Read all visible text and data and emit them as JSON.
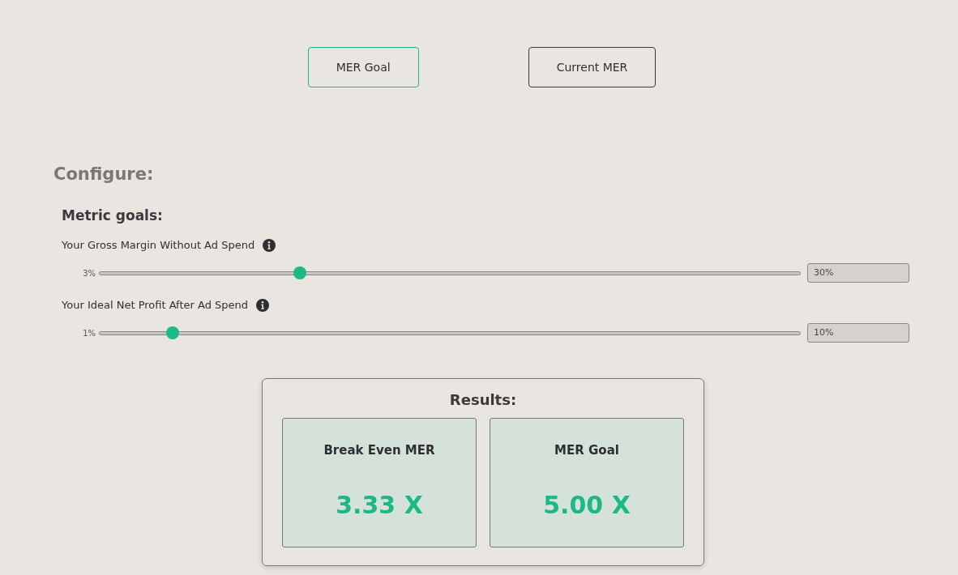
{
  "tabs": [
    {
      "label": "MER Goal",
      "selected": true
    },
    {
      "label": "Current MER",
      "selected": false
    }
  ],
  "configure": {
    "title": "Configure:",
    "section_title": "Metric goals:",
    "sliders": [
      {
        "label": "Your Gross Margin Without Ad Spend",
        "min_label": "3%",
        "level": 0.282,
        "value": "30%"
      },
      {
        "label": "Your Ideal Net Profit After Ad Spend",
        "min_label": "1%",
        "level": 0.098,
        "value": "10%"
      }
    ]
  },
  "results": {
    "title": "Results:",
    "cards": [
      {
        "label": "Break Even MER",
        "value": "3.33 X"
      },
      {
        "label": "MER Goal",
        "value": "5.00 X"
      }
    ]
  }
}
